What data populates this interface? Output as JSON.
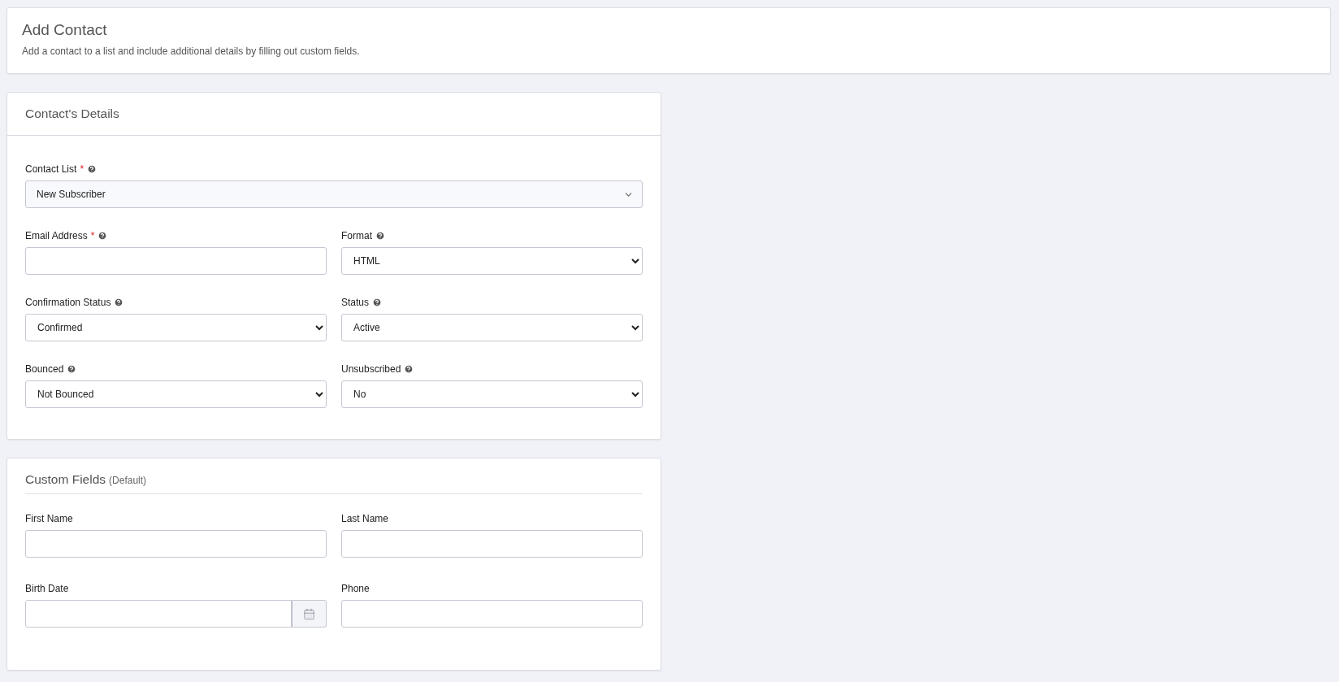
{
  "header": {
    "title": "Add Contact",
    "description": "Add a contact to a list and include additional details by filling out custom fields."
  },
  "details": {
    "title": "Contact's Details",
    "rows": [
      [
        {
          "label": "Contact List",
          "marker": "*",
          "help": true,
          "kind": "dropdown",
          "value": "New Subscriber"
        }
      ],
      [
        {
          "label": "Email Address",
          "marker": "*",
          "help": true,
          "kind": "text"
        },
        {
          "label": "Format",
          "help": true,
          "kind": "select",
          "value": "HTML"
        }
      ],
      [
        {
          "label": "Confirmation Status",
          "help": true,
          "kind": "select",
          "value": "Confirmed"
        },
        {
          "label": "Status",
          "help": true,
          "kind": "select",
          "value": "Active"
        }
      ],
      [
        {
          "label": "Bounced",
          "help": true,
          "kind": "select",
          "value": "Not Bounced"
        },
        {
          "label": "Unsubscribed",
          "help": true,
          "kind": "select",
          "value": "No"
        }
      ]
    ]
  },
  "custom": {
    "title": "Custom Fields",
    "note": "(Default)",
    "rows": [
      [
        {
          "label": "First Name",
          "help": false,
          "kind": "text"
        },
        {
          "label": "Last Name",
          "help": false,
          "kind": "text"
        }
      ],
      [
        {
          "label": "Birth Date",
          "help": false,
          "kind": "date"
        },
        {
          "label": "Phone",
          "help": false,
          "kind": "text"
        }
      ]
    ]
  }
}
